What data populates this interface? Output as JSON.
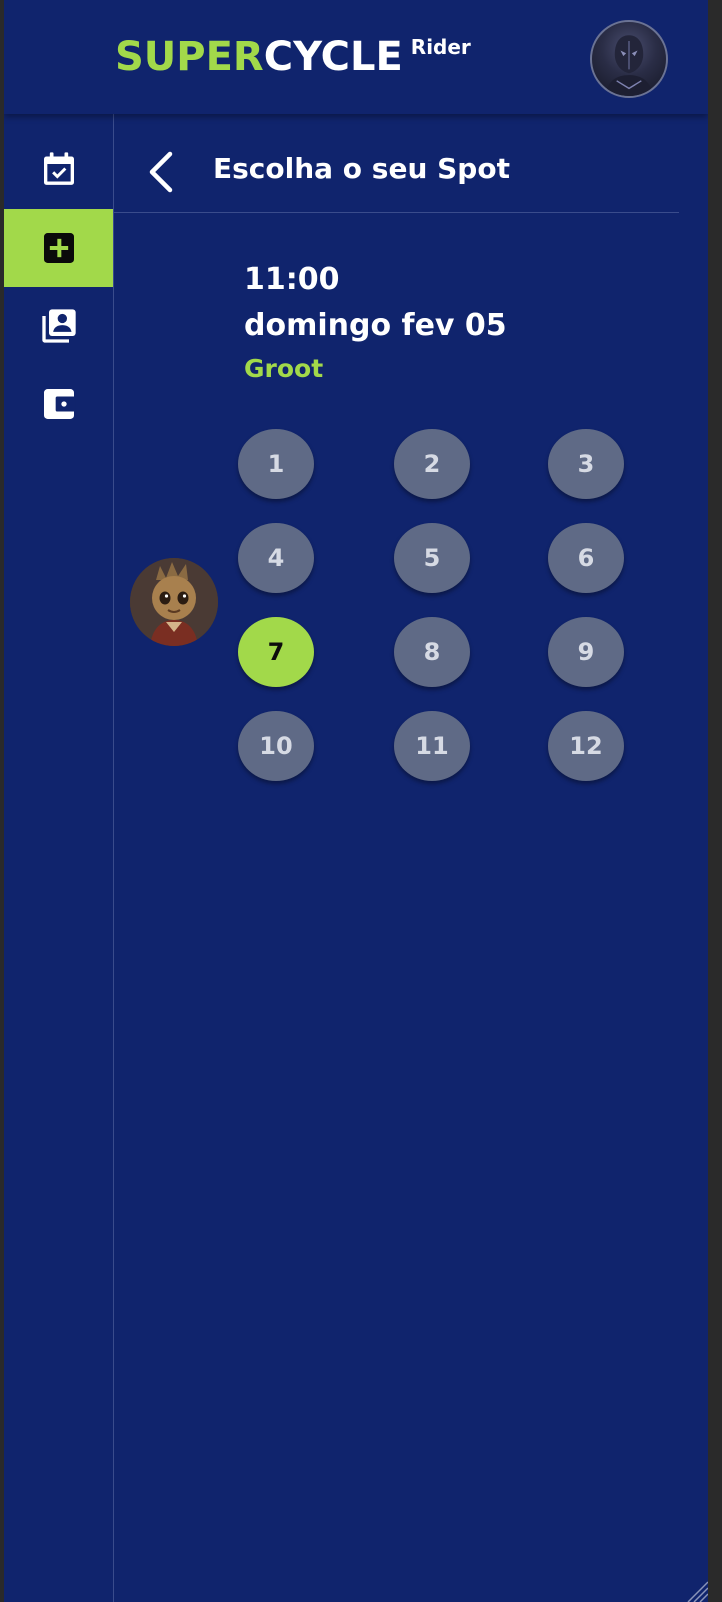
{
  "header": {
    "brand_super": "SUPER",
    "brand_cycle": "CYCLE",
    "brand_rider": "Rider",
    "avatar_icon": "user-avatar"
  },
  "sidebar": {
    "items": [
      {
        "name": "calendar-check-icon",
        "active": false
      },
      {
        "name": "add-box-icon",
        "active": true
      },
      {
        "name": "profile-library-icon",
        "active": false
      },
      {
        "name": "wallet-icon",
        "active": false
      }
    ]
  },
  "page": {
    "title": "Escolha o seu Spot",
    "back_icon": "chevron-left-icon"
  },
  "class_info": {
    "time": "11:00",
    "date": "domingo fev 05",
    "instructor": "Groot"
  },
  "spots": [
    "1",
    "2",
    "3",
    "4",
    "5",
    "6",
    "7",
    "8",
    "9",
    "10",
    "11",
    "12"
  ],
  "selected_spot": "7",
  "colors": {
    "background": "#10246d",
    "accent": "#a2d94a",
    "spot": "#5f6a86",
    "text": "#ffffff"
  }
}
